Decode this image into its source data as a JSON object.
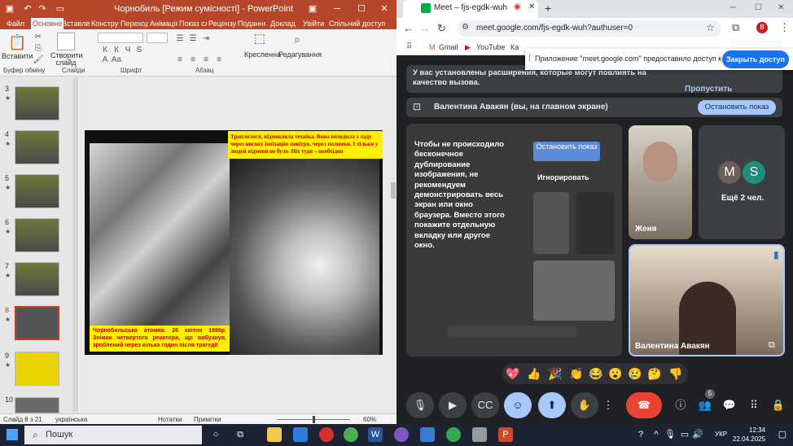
{
  "powerpoint": {
    "title": "Чорнобиль [Режим сумісності] - PowerPoint",
    "tabs": [
      "Файл",
      "Основне",
      "Вставлення",
      "Конструктор",
      "Переходи",
      "Анімація",
      "Показ слайдів",
      "Рецензування",
      "Подання",
      "Доклад",
      "Увійти",
      "Спільний доступ"
    ],
    "ribbon": {
      "paste": "Вставити",
      "new_slide": "Створити слайд",
      "clipboard": "Буфер обміну",
      "slides": "Слайди",
      "font": "Шрифт",
      "paragraph": "Абзац",
      "drawing": "Кресленна",
      "editing": "Редагування"
    },
    "thumbnail_numbers": [
      "3",
      "4",
      "5",
      "6",
      "7",
      "8",
      "9",
      "10"
    ],
    "slide": {
      "caption_top": "Траплялося, відмовляла техніка. Вона виходила з ладу через високу іонізацію повітря, через поломки. І тільки у людей відмови не було. Ніх туди – необхідно",
      "caption_bottom": "Чорнобильська атомна. 26 квітня 1986р. Знімок четвертого реактора, що вибухнув, зроблений через кілька годин після трагедії"
    },
    "status": {
      "slide_pos": "Слайд 8 з 21",
      "language": "українська",
      "notes": "Нотатки",
      "comments": "Примітки",
      "zoom": "60%"
    }
  },
  "chrome": {
    "tab_title": "Meet – fjs-egdk-wuh",
    "url": "meet.google.com/fjs-egdk-wuh?authuser=0",
    "bookmarks": [
      "Gmail",
      "YouTube",
      "Ка"
    ],
    "profile_letter": "В",
    "access_message": "Приложение \"meet.google.com\" предоставило доступ к окну.",
    "access_button": "Закрыть доступ"
  },
  "meet": {
    "warning": "У вас установлены расширения, которые могут повлиять на качество вызова.",
    "skip": "Пропустить",
    "presenting": "Валентина Авакян (вы, на главном экране)",
    "stop_button": "Остановить показ",
    "overlay_text": "Чтобы не происходило бесконечное дублирование изображения, не рекомендуем демонстрировать весь экран или окно браузера. Вместо этого покажите отдельную вкладку или другое окно.",
    "overlay_stop": "Остановить показ",
    "overlay_ignore": "Игнорировать",
    "participants": {
      "zhenya": "Женя",
      "more_count": "Ещё 2 чел.",
      "avatar1": "M",
      "avatar2": "S",
      "self": "Валентина Авакян"
    },
    "people_badge": "5",
    "accent": "#a8c7fa"
  },
  "taskbar": {
    "search_placeholder": "Пошук",
    "language": "УКР",
    "time": "12:34",
    "date": "22.04.2025"
  }
}
